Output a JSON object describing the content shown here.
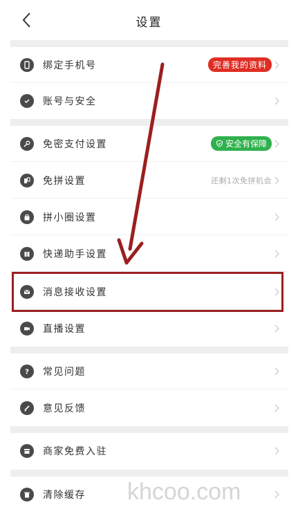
{
  "header": {
    "title": "设置"
  },
  "groups": [
    {
      "items": [
        {
          "label": "绑定手机号",
          "badge": "完善我的资料",
          "badge_type": "red",
          "icon": "phone-icon"
        },
        {
          "label": "账号与安全",
          "icon": "shield-icon"
        }
      ]
    },
    {
      "items": [
        {
          "label": "免密支付设置",
          "badge": "安全有保障",
          "badge_type": "green",
          "icon": "key-icon"
        },
        {
          "label": "免拼设置",
          "hint": "还剩1次免拼机会",
          "icon": "group-icon"
        },
        {
          "label": "拼小圈设置",
          "icon": "bag-icon"
        },
        {
          "label": "快递助手设置",
          "icon": "package-icon"
        },
        {
          "label": "消息接收设置",
          "icon": "mail-icon"
        },
        {
          "label": "直播设置",
          "icon": "video-icon"
        }
      ]
    },
    {
      "items": [
        {
          "label": "常见问题",
          "icon": "question-icon"
        },
        {
          "label": "意见反馈",
          "icon": "edit-icon"
        }
      ]
    },
    {
      "items": [
        {
          "label": "商家免费入驻",
          "icon": "store-icon"
        }
      ]
    },
    {
      "items": [
        {
          "label": "清除缓存",
          "icon": "trash-icon"
        }
      ]
    }
  ],
  "watermark": "khcoo.com",
  "colors": {
    "accent_red": "#e02e24",
    "accent_green": "#2fb14d",
    "annotation": "#9b1f1f"
  }
}
